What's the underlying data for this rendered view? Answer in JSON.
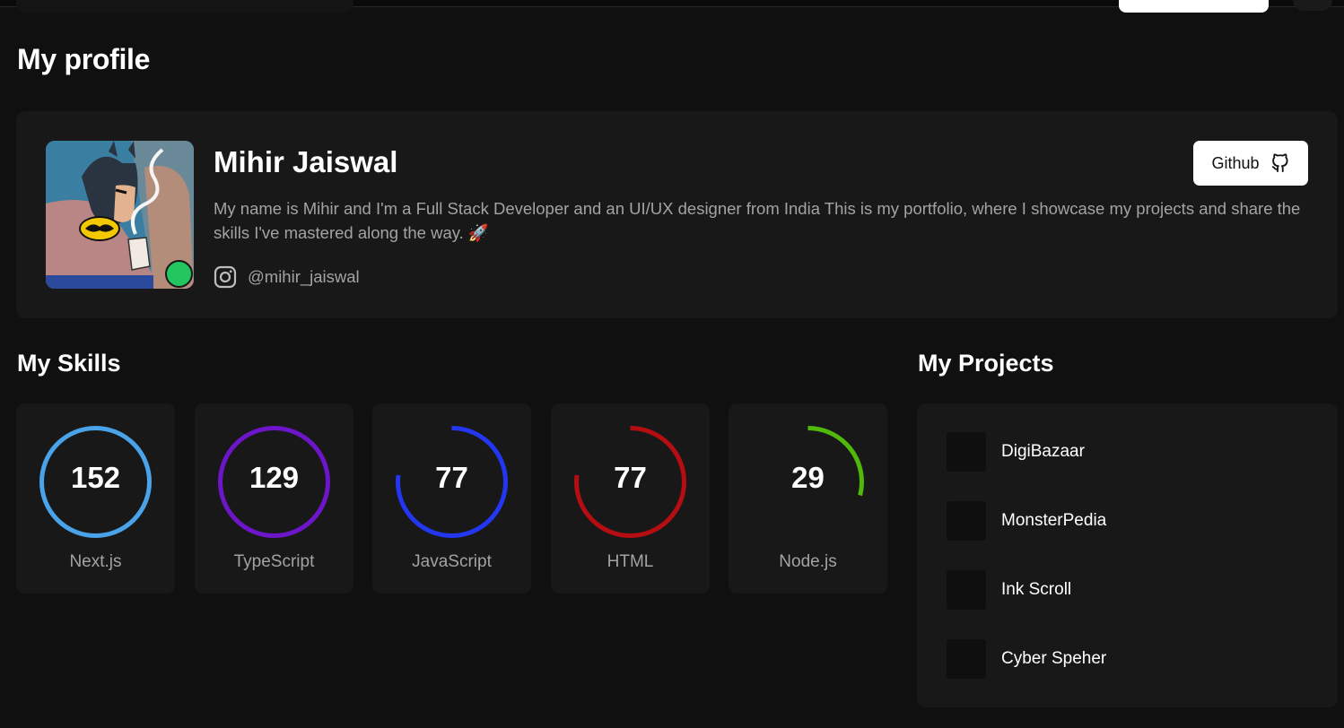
{
  "page": {
    "title": "My profile"
  },
  "profile": {
    "name": "Mihir Jaiswal",
    "bio": "My name is Mihir and I'm a Full Stack Developer and an UI/UX designer from India This is my portfolio, where I showcase my projects and share the skills I've mastered along the way. 🚀",
    "instagram_handle": "@mihir_jaiswal",
    "status_color": "#22c55e",
    "avatar_icon": "batman-avatar",
    "social_icon": "instagram-icon",
    "github_button": {
      "label": "Github",
      "icon": "github-icon"
    }
  },
  "skills": {
    "title": "My Skills",
    "items": [
      {
        "value": "152",
        "label": "Next.js",
        "progress": 1.0,
        "color": "#4aa3e8"
      },
      {
        "value": "129",
        "label": "TypeScript",
        "progress": 1.0,
        "color": "#6d16c9"
      },
      {
        "value": "77",
        "label": "JavaScript",
        "progress": 0.77,
        "color": "#2336f0"
      },
      {
        "value": "77",
        "label": "HTML",
        "progress": 0.77,
        "color": "#b50d12"
      },
      {
        "value": "29",
        "label": "Node.js",
        "progress": 0.29,
        "color": "#4fb80a"
      }
    ]
  },
  "projects": {
    "title": "My Projects",
    "items": [
      {
        "name": "DigiBazaar"
      },
      {
        "name": "MonsterPedia"
      },
      {
        "name": "Ink Scroll"
      },
      {
        "name": "Cyber Speher"
      }
    ]
  }
}
